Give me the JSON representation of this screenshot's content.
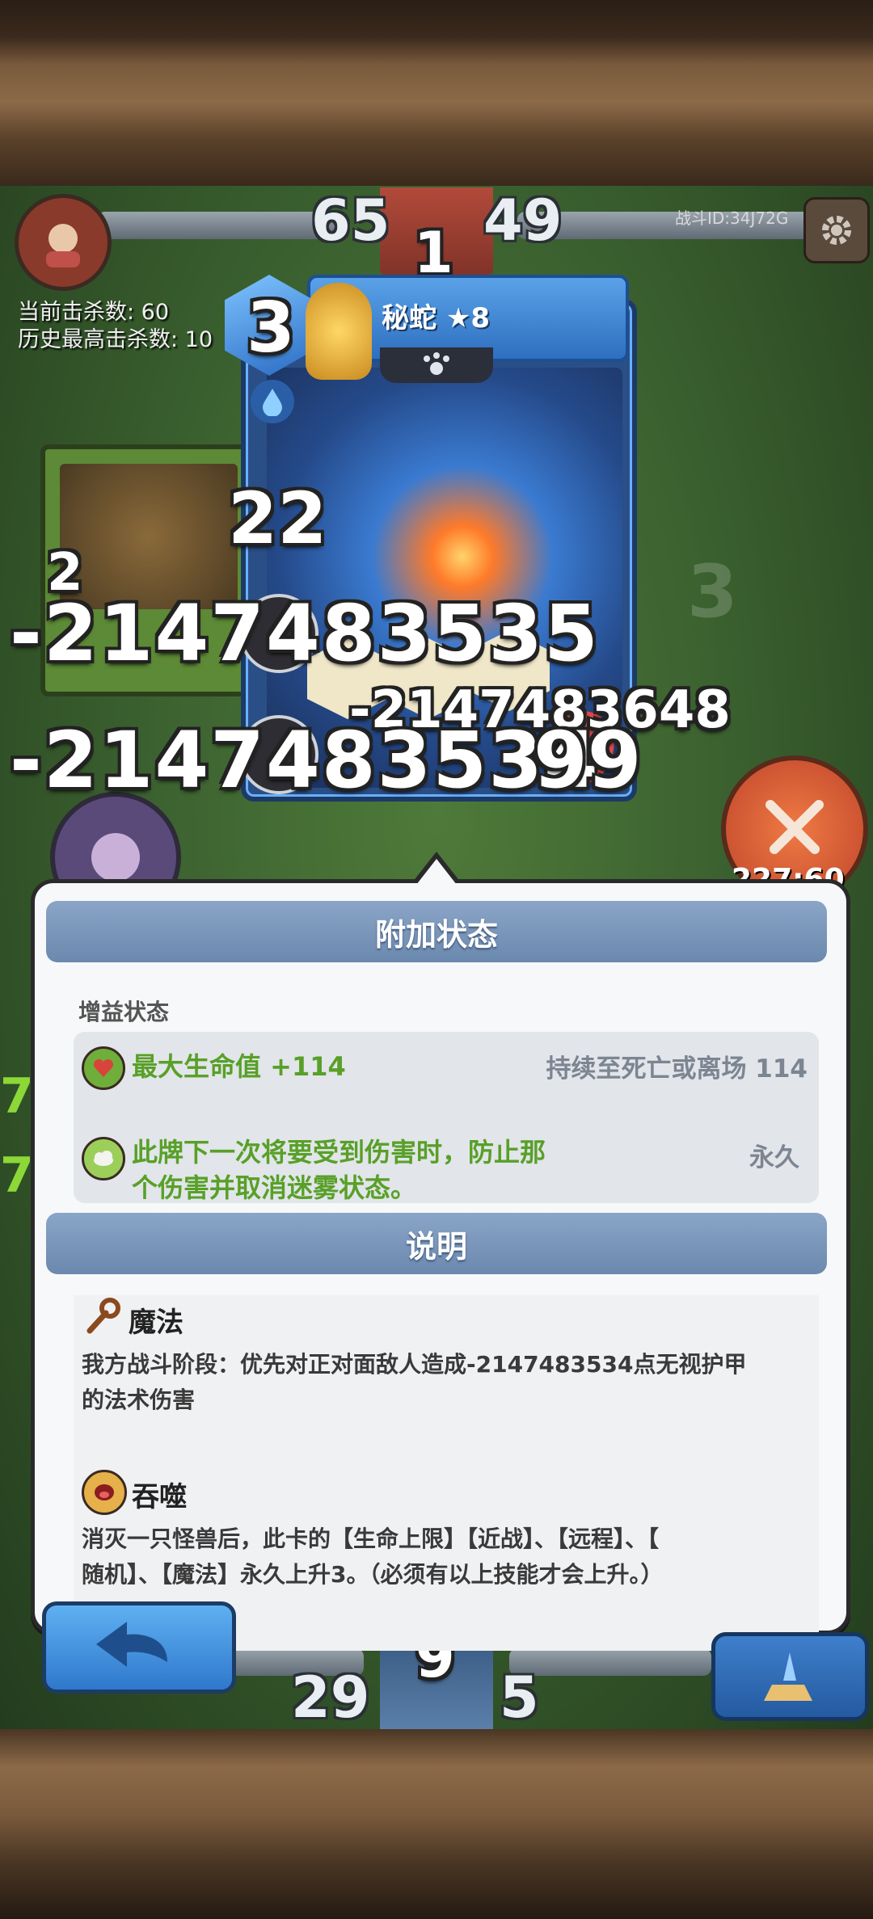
{
  "hud": {
    "top_left_score": "65",
    "top_right_score": "49",
    "top_center": "1",
    "battle_id": "战斗ID:34J72G",
    "current_kills_label": "当前击杀数: 60",
    "best_kills_label": "历史最高击杀数: 10",
    "bottom_left_score": "29",
    "bottom_right_score": "5",
    "bottom_center": "9",
    "side_number": "3",
    "timer_partial": "227:60",
    "left_edge_number": "7",
    "left_edge_number_2": "7"
  },
  "card": {
    "cost": "3",
    "name": "秘蛇 ★8",
    "health": "22"
  },
  "enemy_card": {
    "health": "2"
  },
  "floating_numbers": [
    "-2147483535",
    "-2147483648",
    "-2147483534",
    "99"
  ],
  "panel": {
    "status_header": "附加状态",
    "buff_subheader": "增益状态",
    "buffs": [
      {
        "text": "最大生命值 +114",
        "duration": "持续至死亡或离场 114",
        "icon": "heart-icon"
      },
      {
        "text": "此牌下一次将要受到伤害时，防止那个伤害并取消迷雾状态。",
        "line1": "此牌下一次将要受到伤害时，防止那",
        "line2": "个伤害并取消迷雾状态。",
        "duration": "永久",
        "icon": "fog-icon"
      }
    ],
    "desc_header": "说明",
    "skills": [
      {
        "name": "魔法",
        "icon": "magic-staff-icon",
        "line1": "我方战斗阶段：优先对正对面敌人造成-2147483534点无视护甲",
        "line2": "的法术伤害"
      },
      {
        "name": "吞噬",
        "icon": "devour-icon",
        "line1": "消灭一只怪兽后，此卡的【生命上限】【近战】、【远程】、【",
        "line2": "随机】、【魔法】永久上升3。（必须有以上技能才会上升。）"
      }
    ]
  },
  "buttons": {
    "back": "back-arrow-icon",
    "confirm": "deck-icon",
    "attack": "crossed-swords-icon",
    "settings": "gear-icon"
  }
}
